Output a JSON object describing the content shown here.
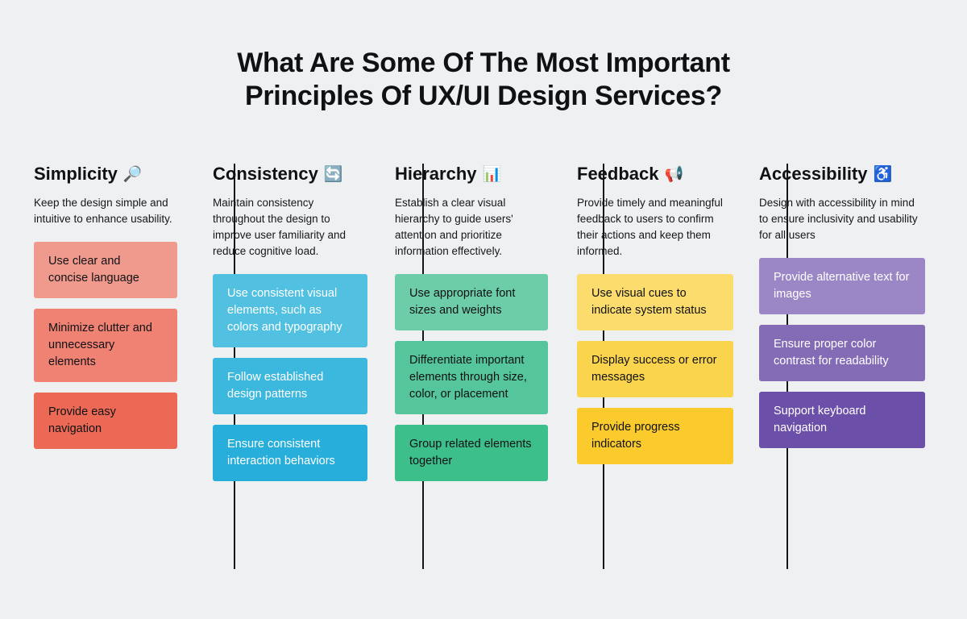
{
  "title": {
    "line1": "What Are Some Of The Most Important",
    "line2": "Principles Of UX/UI Design Services?"
  },
  "background_color": "#eff0f2",
  "divider_color": "#14161a",
  "columns": [
    {
      "heading": "Simplicity",
      "emoji": "🔎",
      "emoji_name": "magnifying-glass-icon",
      "description": "Keep the design simple and intuitive to enhance usability.",
      "text_color": "#15171b",
      "cards": [
        {
          "text": "Use clear and concise language",
          "bg": "#f09a8e",
          "fg": "#101114"
        },
        {
          "text": "Minimize clutter and unnecessary elements",
          "bg": "#ef8273",
          "fg": "#101114"
        },
        {
          "text": "Provide easy navigation",
          "bg": "#ec6a55",
          "fg": "#101114"
        }
      ]
    },
    {
      "heading": "Consistency",
      "emoji": "🔄",
      "emoji_name": "refresh-sync-icon",
      "description": "Maintain consistency throughout the design to improve user familiarity and reduce cognitive load.",
      "text_color": "#15171b",
      "cards": [
        {
          "text": "Use consistent visual elements, such as colors and typography",
          "bg": "#52c0e0",
          "fg": "#ffffff"
        },
        {
          "text": "Follow established design patterns",
          "bg": "#3cb7dd",
          "fg": "#ffffff"
        },
        {
          "text": "Ensure consistent interaction behaviors",
          "bg": "#27aedb",
          "fg": "#ffffff"
        }
      ]
    },
    {
      "heading": "Hierarchy",
      "emoji": "📊",
      "emoji_name": "bar-chart-icon",
      "description": "Establish a clear visual hierarchy to guide users' attention and prioritize information effectively.",
      "text_color": "#15171b",
      "cards": [
        {
          "text": "Use appropriate font sizes and weights",
          "bg": "#6dcda9",
          "fg": "#101114"
        },
        {
          "text": "Differentiate important elements through size, color, or placement",
          "bg": "#55c69b",
          "fg": "#101114"
        },
        {
          "text": "Group related elements together",
          "bg": "#3dbf8c",
          "fg": "#101114"
        }
      ]
    },
    {
      "heading": "Feedback",
      "emoji": "📢",
      "emoji_name": "megaphone-icon",
      "description": "Provide timely and meaningful feedback to users to confirm their actions and keep them informed.",
      "text_color": "#15171b",
      "cards": [
        {
          "text": "Use visual cues to indicate system status",
          "bg": "#fcdc6d",
          "fg": "#101114"
        },
        {
          "text": "Display success or error messages",
          "bg": "#fbd44d",
          "fg": "#101114"
        },
        {
          "text": "Provide progress indicators",
          "bg": "#fbcb2e",
          "fg": "#101114"
        }
      ]
    },
    {
      "heading": "Accessibility",
      "emoji": "♿",
      "emoji_name": "accessibility-wheelchair-icon",
      "description": "Design with accessibility in mind to ensure inclusivity and usability for all users",
      "text_color": "#15171b",
      "cards": [
        {
          "text": "Provide alternative text for images",
          "bg": "#9b87c5",
          "fg": "#ffffff"
        },
        {
          "text": "Ensure proper color contrast for readability",
          "bg": "#836bb6",
          "fg": "#ffffff"
        },
        {
          "text": "Support keyboard navigation",
          "bg": "#6b4fa8",
          "fg": "#ffffff"
        }
      ]
    }
  ]
}
